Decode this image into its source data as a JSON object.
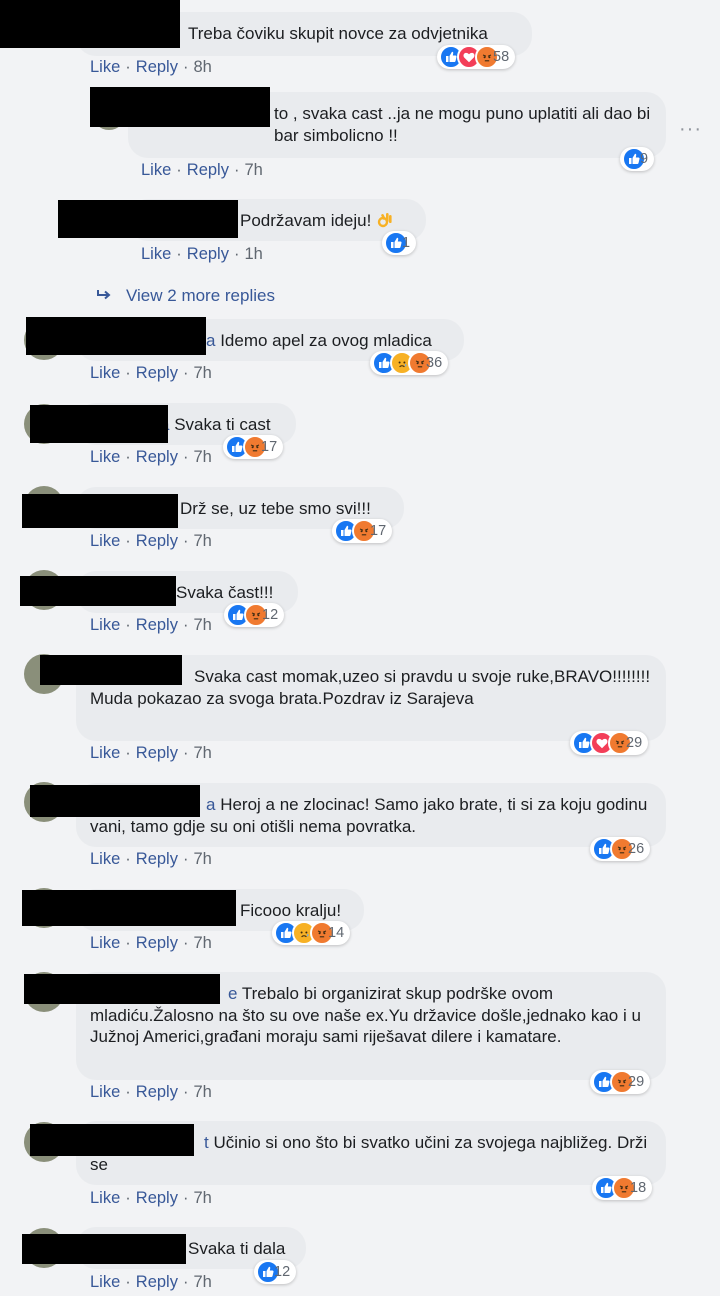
{
  "comments": [
    {
      "text": "Treba čoviku skupit novce za odvjetnika",
      "count": "58",
      "time": "8h",
      "reactions": [
        "like",
        "love",
        "angry"
      ]
    },
    {
      "text": "to , svaka cast ..ja ne mogu puno uplatiti ali dao bi bar simbolicno !!",
      "count": "9",
      "time": "7h",
      "reactions": [
        "like"
      ]
    },
    {
      "text": "Podržavam ideju!",
      "count": "1",
      "time": "1h",
      "reactions": [
        "like"
      ],
      "emoji": "ok-hand-icon"
    },
    {
      "text": "Idemo apel za ovog mladica",
      "name_tail": "a",
      "count": "36",
      "time": "7h",
      "reactions": [
        "like",
        "sad",
        "angry"
      ]
    },
    {
      "text": "Svaka ti cast",
      "name_tail": "a",
      "count": "17",
      "time": "7h",
      "reactions": [
        "like",
        "angry"
      ]
    },
    {
      "text": "Drž se, uz tebe smo svi!!!",
      "count": "17",
      "time": "7h",
      "reactions": [
        "like",
        "angry"
      ]
    },
    {
      "text": "Svaka čast!!!",
      "count": "12",
      "time": "7h",
      "reactions": [
        "like",
        "angry"
      ]
    },
    {
      "text": "Svaka cast momak,uzeo si pravdu u svoje ruke,BRAVO!!!!!!!! Muda pokazao za svoga brata.Pozdrav iz Sarajeva",
      "count": "29",
      "time": "7h",
      "reactions": [
        "like",
        "love",
        "angry"
      ]
    },
    {
      "text": "Heroj a ne zlocinac! Samo jako brate, ti si za koju godinu vani, tamo gdje su oni otišli nema povratka.",
      "name_tail": "a",
      "count": "26",
      "time": "7h",
      "reactions": [
        "like",
        "angry"
      ]
    },
    {
      "text": "Ficooo kralju!",
      "count": "14",
      "time": "7h",
      "reactions": [
        "like",
        "sad",
        "angry"
      ]
    },
    {
      "text": "Trebalo bi organizirat skup podrške ovom mladiću.Žalosno na što su ove naše ex.Yu državice došle,jednako kao i u Južnoj Americi,građani moraju sami riješavat dilere i kamatare.",
      "name_tail": "e",
      "count": "29",
      "time": "7h",
      "reactions": [
        "like",
        "angry"
      ]
    },
    {
      "text": "Učinio si ono što bi svatko učini za svojega najbližeg. Drži se",
      "name_tail": "t",
      "count": "18",
      "time": "7h",
      "reactions": [
        "like",
        "angry"
      ]
    },
    {
      "text": "Svaka ti dala",
      "count": "12",
      "time": "7h",
      "reactions": [
        "like"
      ]
    }
  ],
  "labels": {
    "like": "Like",
    "reply": "Reply",
    "dot": "·",
    "view_more": "View 2 more replies",
    "more": "···"
  },
  "colors": {
    "link": "#385898",
    "bubble": "#e9ebee",
    "background": "#f2f3f5",
    "like": "#1877f2",
    "love": "#f33e58",
    "angry": "#f07a30",
    "sad": "#f7b125"
  }
}
